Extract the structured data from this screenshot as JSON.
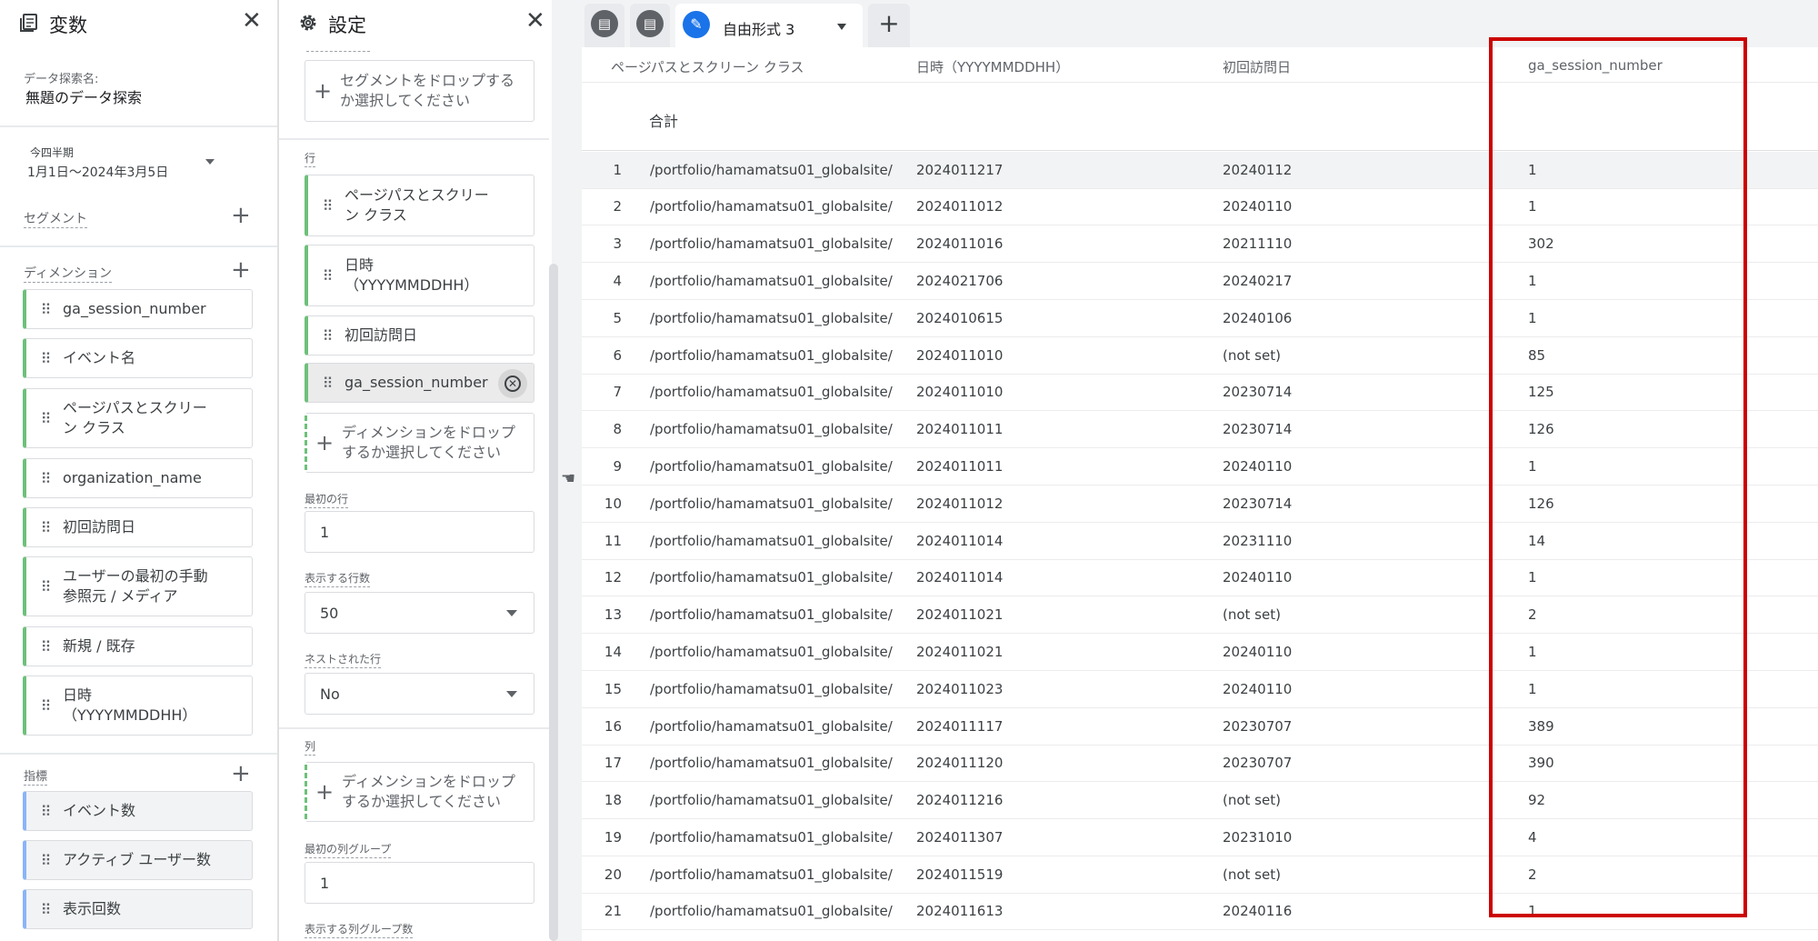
{
  "variables": {
    "title": "変数",
    "exploration_name_label": "データ探索名:",
    "exploration_name": "無題のデータ探索",
    "date_range_label": "今四半期",
    "date_range_value": "1月1日～2024年3月5日",
    "segment_label": "セグメント",
    "dimensions_label": "ディメンション",
    "dimensions": [
      "ga_session_number",
      "イベント名",
      "ページパスとスクリーン クラス",
      "organization_name",
      "初回訪問日",
      "ユーザーの最初の手動参照元 / メディア",
      "新規 / 既存",
      "日時（YYYYMMDDHH）"
    ],
    "metrics_label": "指標",
    "metrics": [
      "イベント数",
      "アクティブ ユーザー数",
      "表示回数"
    ]
  },
  "settings": {
    "title": "設定",
    "segment_drop": "セグメントをドロップするか選択してください",
    "rows_label": "行",
    "rows": [
      "ページパスとスクリーン クラス",
      "日時（YYYYMMDDHH）",
      "初回訪問日",
      "ga_session_number"
    ],
    "dimension_drop": "ディメンションをドロップするか選択してください",
    "first_row_label": "最初の行",
    "first_row_value": "1",
    "rows_to_show_label": "表示する行数",
    "rows_to_show_value": "50",
    "nested_rows_label": "ネストされた行",
    "nested_rows_value": "No",
    "columns_label": "列",
    "column_drop": "ディメンションをドロップするか選択してください",
    "first_col_group_label": "最初の列グループ",
    "first_col_group_value": "1",
    "col_groups_to_show_label": "表示する列グループ数"
  },
  "tabs": {
    "active_label": "自由形式 3"
  },
  "table": {
    "headers": [
      "ページパスとスクリーン クラス",
      "日時（YYYYMMDDHH）",
      "初回訪問日",
      "ga_session_number"
    ],
    "total_label": "合計",
    "rows": [
      [
        "1",
        "/portfolio/hamamatsu01_globalsite/",
        "2024011217",
        "20240112",
        "1"
      ],
      [
        "2",
        "/portfolio/hamamatsu01_globalsite/",
        "2024011012",
        "20240110",
        "1"
      ],
      [
        "3",
        "/portfolio/hamamatsu01_globalsite/",
        "2024011016",
        "20211110",
        "302"
      ],
      [
        "4",
        "/portfolio/hamamatsu01_globalsite/",
        "2024021706",
        "20240217",
        "1"
      ],
      [
        "5",
        "/portfolio/hamamatsu01_globalsite/",
        "2024010615",
        "20240106",
        "1"
      ],
      [
        "6",
        "/portfolio/hamamatsu01_globalsite/",
        "2024011010",
        "(not set)",
        "85"
      ],
      [
        "7",
        "/portfolio/hamamatsu01_globalsite/",
        "2024011010",
        "20230714",
        "125"
      ],
      [
        "8",
        "/portfolio/hamamatsu01_globalsite/",
        "2024011011",
        "20230714",
        "126"
      ],
      [
        "9",
        "/portfolio/hamamatsu01_globalsite/",
        "2024011011",
        "20240110",
        "1"
      ],
      [
        "10",
        "/portfolio/hamamatsu01_globalsite/",
        "2024011012",
        "20230714",
        "126"
      ],
      [
        "11",
        "/portfolio/hamamatsu01_globalsite/",
        "2024011014",
        "20231110",
        "14"
      ],
      [
        "12",
        "/portfolio/hamamatsu01_globalsite/",
        "2024011014",
        "20240110",
        "1"
      ],
      [
        "13",
        "/portfolio/hamamatsu01_globalsite/",
        "2024011021",
        "(not set)",
        "2"
      ],
      [
        "14",
        "/portfolio/hamamatsu01_globalsite/",
        "2024011021",
        "20240110",
        "1"
      ],
      [
        "15",
        "/portfolio/hamamatsu01_globalsite/",
        "2024011023",
        "20240110",
        "1"
      ],
      [
        "16",
        "/portfolio/hamamatsu01_globalsite/",
        "2024011117",
        "20230707",
        "389"
      ],
      [
        "17",
        "/portfolio/hamamatsu01_globalsite/",
        "2024011120",
        "20230707",
        "390"
      ],
      [
        "18",
        "/portfolio/hamamatsu01_globalsite/",
        "2024011216",
        "(not set)",
        "92"
      ],
      [
        "19",
        "/portfolio/hamamatsu01_globalsite/",
        "2024011307",
        "20231010",
        "4"
      ],
      [
        "20",
        "/portfolio/hamamatsu01_globalsite/",
        "2024011519",
        "(not set)",
        "2"
      ],
      [
        "21",
        "/portfolio/hamamatsu01_globalsite/",
        "2024011613",
        "20240116",
        "1"
      ]
    ]
  },
  "colors": {
    "highlight": "#cc0000",
    "dimension_accent": "#6ec07a",
    "metric_accent": "#8ab4f8",
    "tab_accent": "#1a73e8"
  }
}
